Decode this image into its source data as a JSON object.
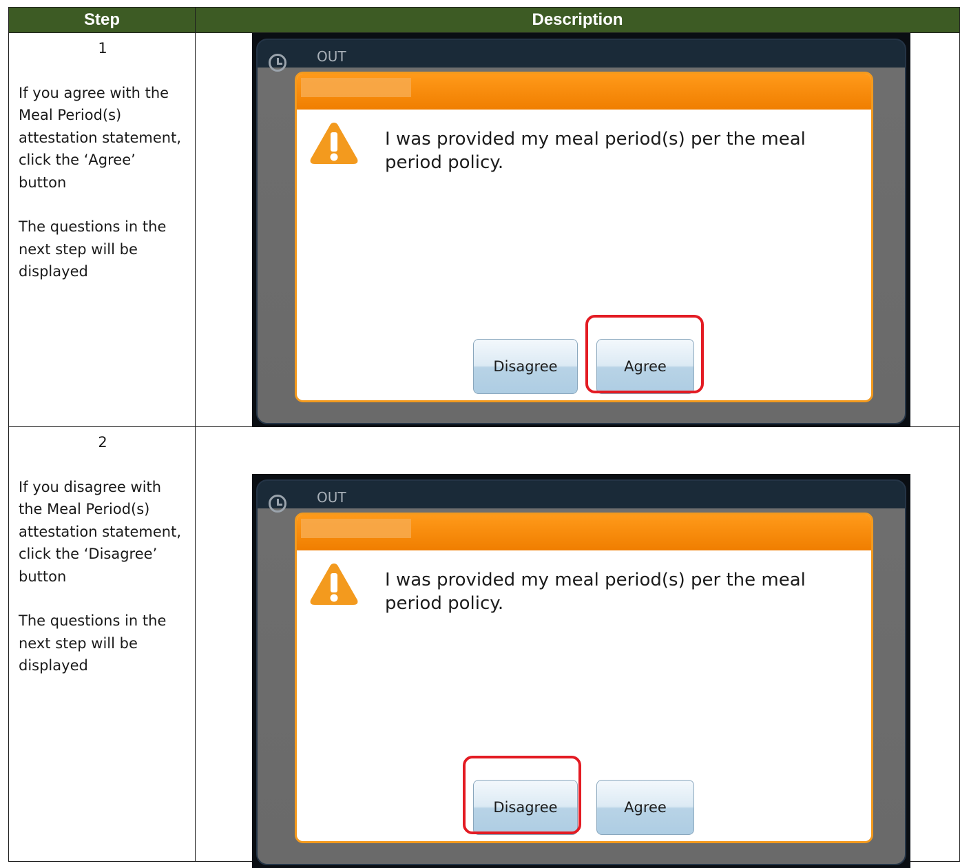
{
  "table": {
    "headers": [
      "Step",
      "Description"
    ]
  },
  "steps": [
    {
      "number": "1",
      "text": "If you agree with the Meal Period(s) attestation statement, click the ‘Agree’ button",
      "note": "The questions in the next step will be displayed",
      "highlighted_button": "Agree"
    },
    {
      "number": "2",
      "text": "If you disagree with the Meal Period(s) attestation statement, click the ‘Disagree’ button",
      "note": "The questions in the next step will be displayed",
      "highlighted_button": "Disagree"
    }
  ],
  "dialog": {
    "status_label": "OUT",
    "message": "I was provided my meal period(s) per the meal period policy.",
    "disagree_label": "Disagree",
    "agree_label": "Agree"
  },
  "colors": {
    "header_bg": "#3d5b24",
    "dialog_accent": "#f39a1e",
    "highlight": "#e31b23"
  },
  "icons": [
    "clock-icon",
    "warning-icon"
  ]
}
